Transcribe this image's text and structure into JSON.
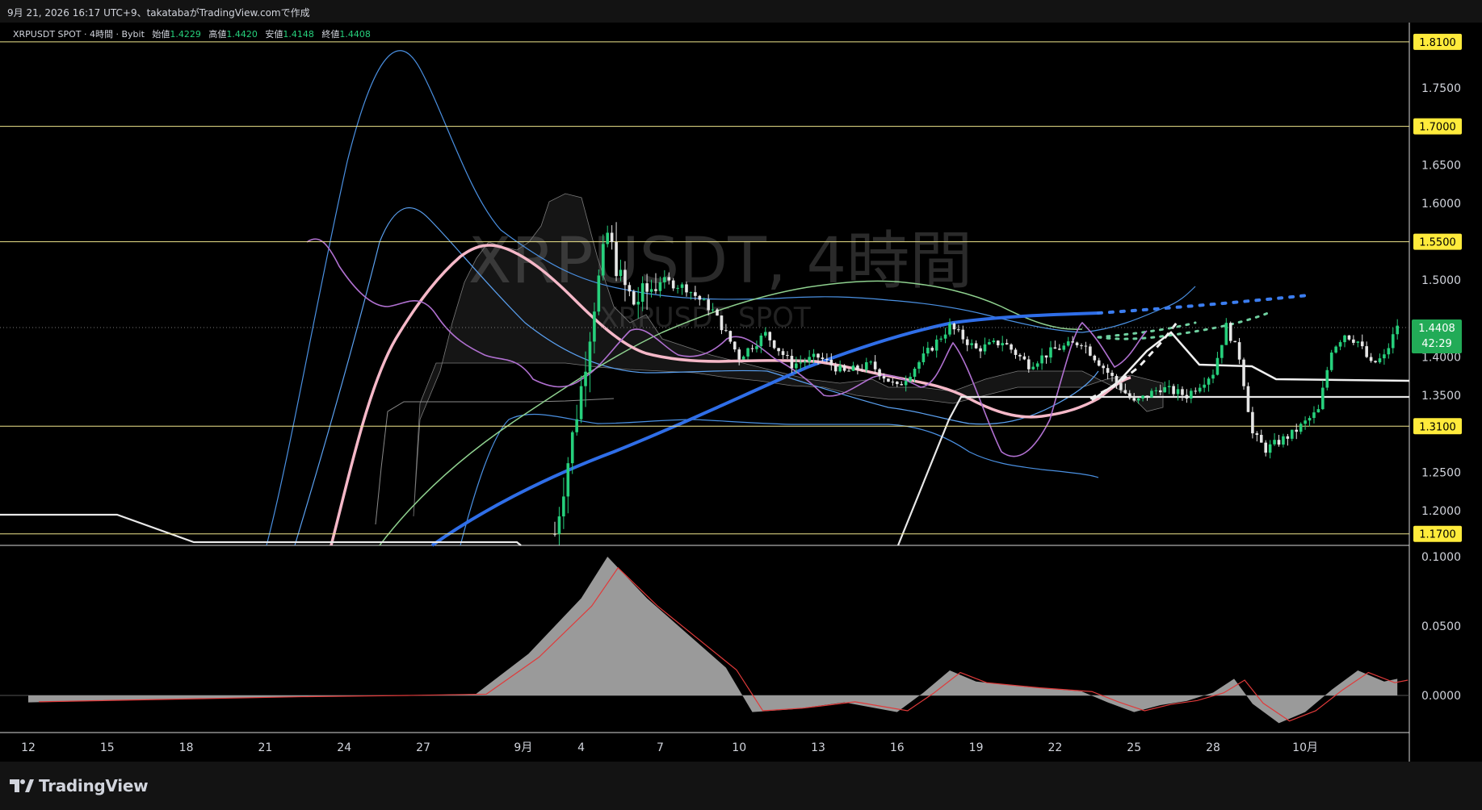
{
  "header": {
    "text": "9月 21, 2026 16:17 UTC+9、takatabaがTradingView.comで作成"
  },
  "legend": {
    "symbol": "XRPUSDT SPOT · 4時間 · Bybit",
    "open_label": "始値",
    "open": "1.4229",
    "high_label": "高値",
    "high": "1.4420",
    "low_label": "安値",
    "low": "1.4148",
    "close_label": "終値",
    "close": "1.4408"
  },
  "watermark": {
    "main": "XRPUSDT, 4時間",
    "sub": "XRPUSDT SPOT"
  },
  "price_badge": {
    "price": "1.4408",
    "countdown": "42:29"
  },
  "brand": "TradingView",
  "colors": {
    "bull": "#26d07c",
    "bear": "#e6e6e6",
    "hline": "#f0e68c",
    "badge_yellow": "#ffeb3b",
    "badge_green": "#22ab57",
    "ma_pink": "#f5b8c8",
    "ma_blue": "#2f6ee8",
    "ma_green": "#8fd18f",
    "bb_blue": "#4a90e2",
    "purple": "#b070d0",
    "white": "#e8e8e8"
  },
  "chart_data": {
    "type": "candlestick",
    "title": "XRPUSDT, 4時間",
    "x_ticks": [
      "12",
      "15",
      "18",
      "21",
      "24",
      "27",
      "9月",
      "4",
      "7",
      "10",
      "13",
      "16",
      "19",
      "22",
      "25",
      "28",
      "10月"
    ],
    "y_ticks": [
      "1.2000",
      "1.2500",
      "1.3500",
      "1.4000",
      "1.5000",
      "1.6000",
      "1.6500",
      "1.7500"
    ],
    "price_range": [
      1.155,
      1.835
    ],
    "horizontal_levels": [
      "1.8100",
      "1.7000",
      "1.5500",
      "1.3100",
      "1.1700"
    ],
    "last_price": 1.4408,
    "series_trend": [
      {
        "day": 20.0,
        "price": 1.17
      },
      {
        "day": 21.0,
        "price": 1.36
      },
      {
        "day": 21.5,
        "price": 1.47
      },
      {
        "day": 22.0,
        "price": 1.56
      },
      {
        "day": 22.5,
        "price": 1.5
      },
      {
        "day": 23.0,
        "price": 1.47
      },
      {
        "day": 24.0,
        "price": 1.5
      },
      {
        "day": 25.0,
        "price": 1.49
      },
      {
        "day": 26.0,
        "price": 1.46
      },
      {
        "day": 27.0,
        "price": 1.4
      },
      {
        "day": 28.0,
        "price": 1.43
      },
      {
        "day": 29.0,
        "price": 1.39
      },
      {
        "day": 30.0,
        "price": 1.4
      },
      {
        "day": 31.0,
        "price": 1.38
      },
      {
        "day": 32.0,
        "price": 1.39
      },
      {
        "day": 33.0,
        "price": 1.36
      },
      {
        "day": 34.0,
        "price": 1.4
      },
      {
        "day": 35.0,
        "price": 1.44
      },
      {
        "day": 36.0,
        "price": 1.41
      },
      {
        "day": 37.0,
        "price": 1.42
      },
      {
        "day": 38.0,
        "price": 1.39
      },
      {
        "day": 39.0,
        "price": 1.41
      },
      {
        "day": 40.0,
        "price": 1.42
      },
      {
        "day": 41.0,
        "price": 1.38
      },
      {
        "day": 42.0,
        "price": 1.34
      },
      {
        "day": 43.0,
        "price": 1.36
      },
      {
        "day": 44.0,
        "price": 1.35
      },
      {
        "day": 45.0,
        "price": 1.38
      },
      {
        "day": 45.5,
        "price": 1.44
      },
      {
        "day": 46.0,
        "price": 1.4
      },
      {
        "day": 46.5,
        "price": 1.3
      },
      {
        "day": 47.0,
        "price": 1.28
      },
      {
        "day": 48.0,
        "price": 1.3
      },
      {
        "day": 49.0,
        "price": 1.33
      },
      {
        "day": 49.5,
        "price": 1.41
      },
      {
        "day": 50.0,
        "price": 1.43
      },
      {
        "day": 50.5,
        "price": 1.42
      },
      {
        "day": 51.0,
        "price": 1.39
      },
      {
        "day": 51.5,
        "price": 1.4
      },
      {
        "day": 52.0,
        "price": 1.44
      }
    ],
    "oscillator": {
      "y_ticks": [
        "0.1000",
        "0.0500",
        "0.0000"
      ],
      "range": [
        -0.025,
        0.1
      ]
    }
  }
}
